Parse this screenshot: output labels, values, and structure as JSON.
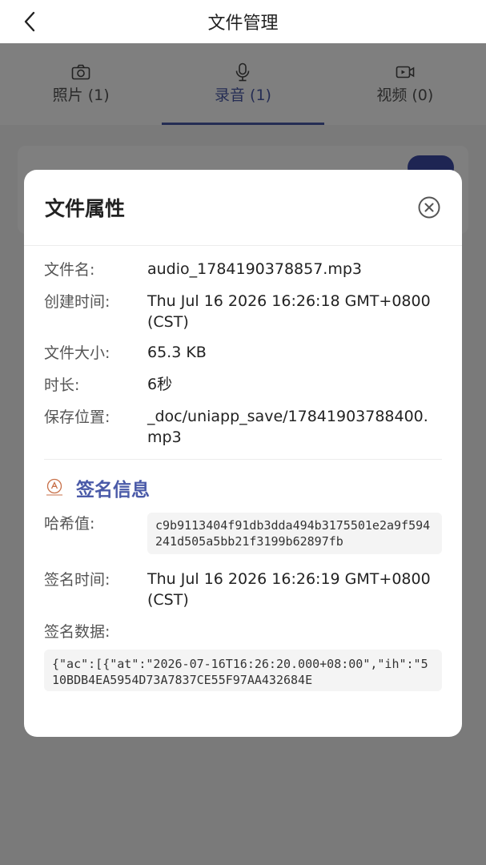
{
  "navbar": {
    "title": "文件管理"
  },
  "tabs": [
    {
      "label": "照片 (1)",
      "icon": "camera-icon"
    },
    {
      "label": "录音 (1)",
      "icon": "microphone-icon",
      "active": true
    },
    {
      "label": "视频 (0)",
      "icon": "video-icon"
    }
  ],
  "modal": {
    "title": "文件属性",
    "fields": [
      {
        "label": "文件名:",
        "value": "audio_1784190378857.mp3"
      },
      {
        "label": "创建时间:",
        "value": "Thu Jul 16 2026 16:26:18 GMT+0800 (CST)"
      },
      {
        "label": "文件大小:",
        "value": "65.3 KB"
      },
      {
        "label": "时长:",
        "value": "6秒"
      },
      {
        "label": "保存位置:",
        "value": "_doc/uniapp_save/17841903788400.mp3"
      }
    ],
    "signature": {
      "title": "签名信息",
      "hash_label": "哈希值:",
      "hash_value": "c9b9113404f91db3dda494b3175501e2a9f594241d505a5bb21f3199b62897fb",
      "time_label": "签名时间:",
      "time_value": "Thu Jul 16 2026 16:26:19 GMT+0800 (CST)",
      "data_label": "签名数据:",
      "data_value": "{\"ac\":[{\"at\":\"2026-07-16T16:26:20.000+08:00\",\"ih\":\"510BDB4EA5954D73A7837CE55F97AA432684E"
    }
  },
  "colors": {
    "accent": "#4a5aa8",
    "button": "#3c4aa6"
  }
}
